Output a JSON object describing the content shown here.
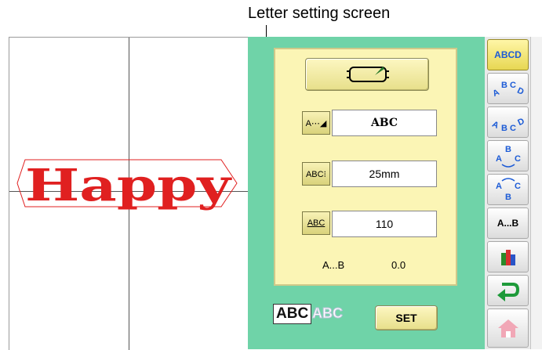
{
  "caption": "Letter setting screen",
  "canvas": {
    "text": "Happy",
    "text_color": "#e02020"
  },
  "panel": {
    "row1": {
      "icon_text": "A⋯◢",
      "value": "ABC"
    },
    "row2": {
      "icon_text": "ABC⁝",
      "value": "25mm"
    },
    "row3": {
      "icon_text": "ABC",
      "value": "110"
    },
    "spacing": {
      "label": "A...B",
      "value": "0.0"
    },
    "mode": {
      "active": "ABC",
      "inactive": "ABC"
    },
    "set_label": "SET"
  },
  "sidebar": {
    "abcd": "ABCD",
    "ab": "A...B"
  },
  "colors": {
    "panel_bg": "#6fd3a8",
    "inner_bg": "#fbf5b5",
    "accent_blue": "#1c5bd6",
    "design_red": "#e02020"
  }
}
